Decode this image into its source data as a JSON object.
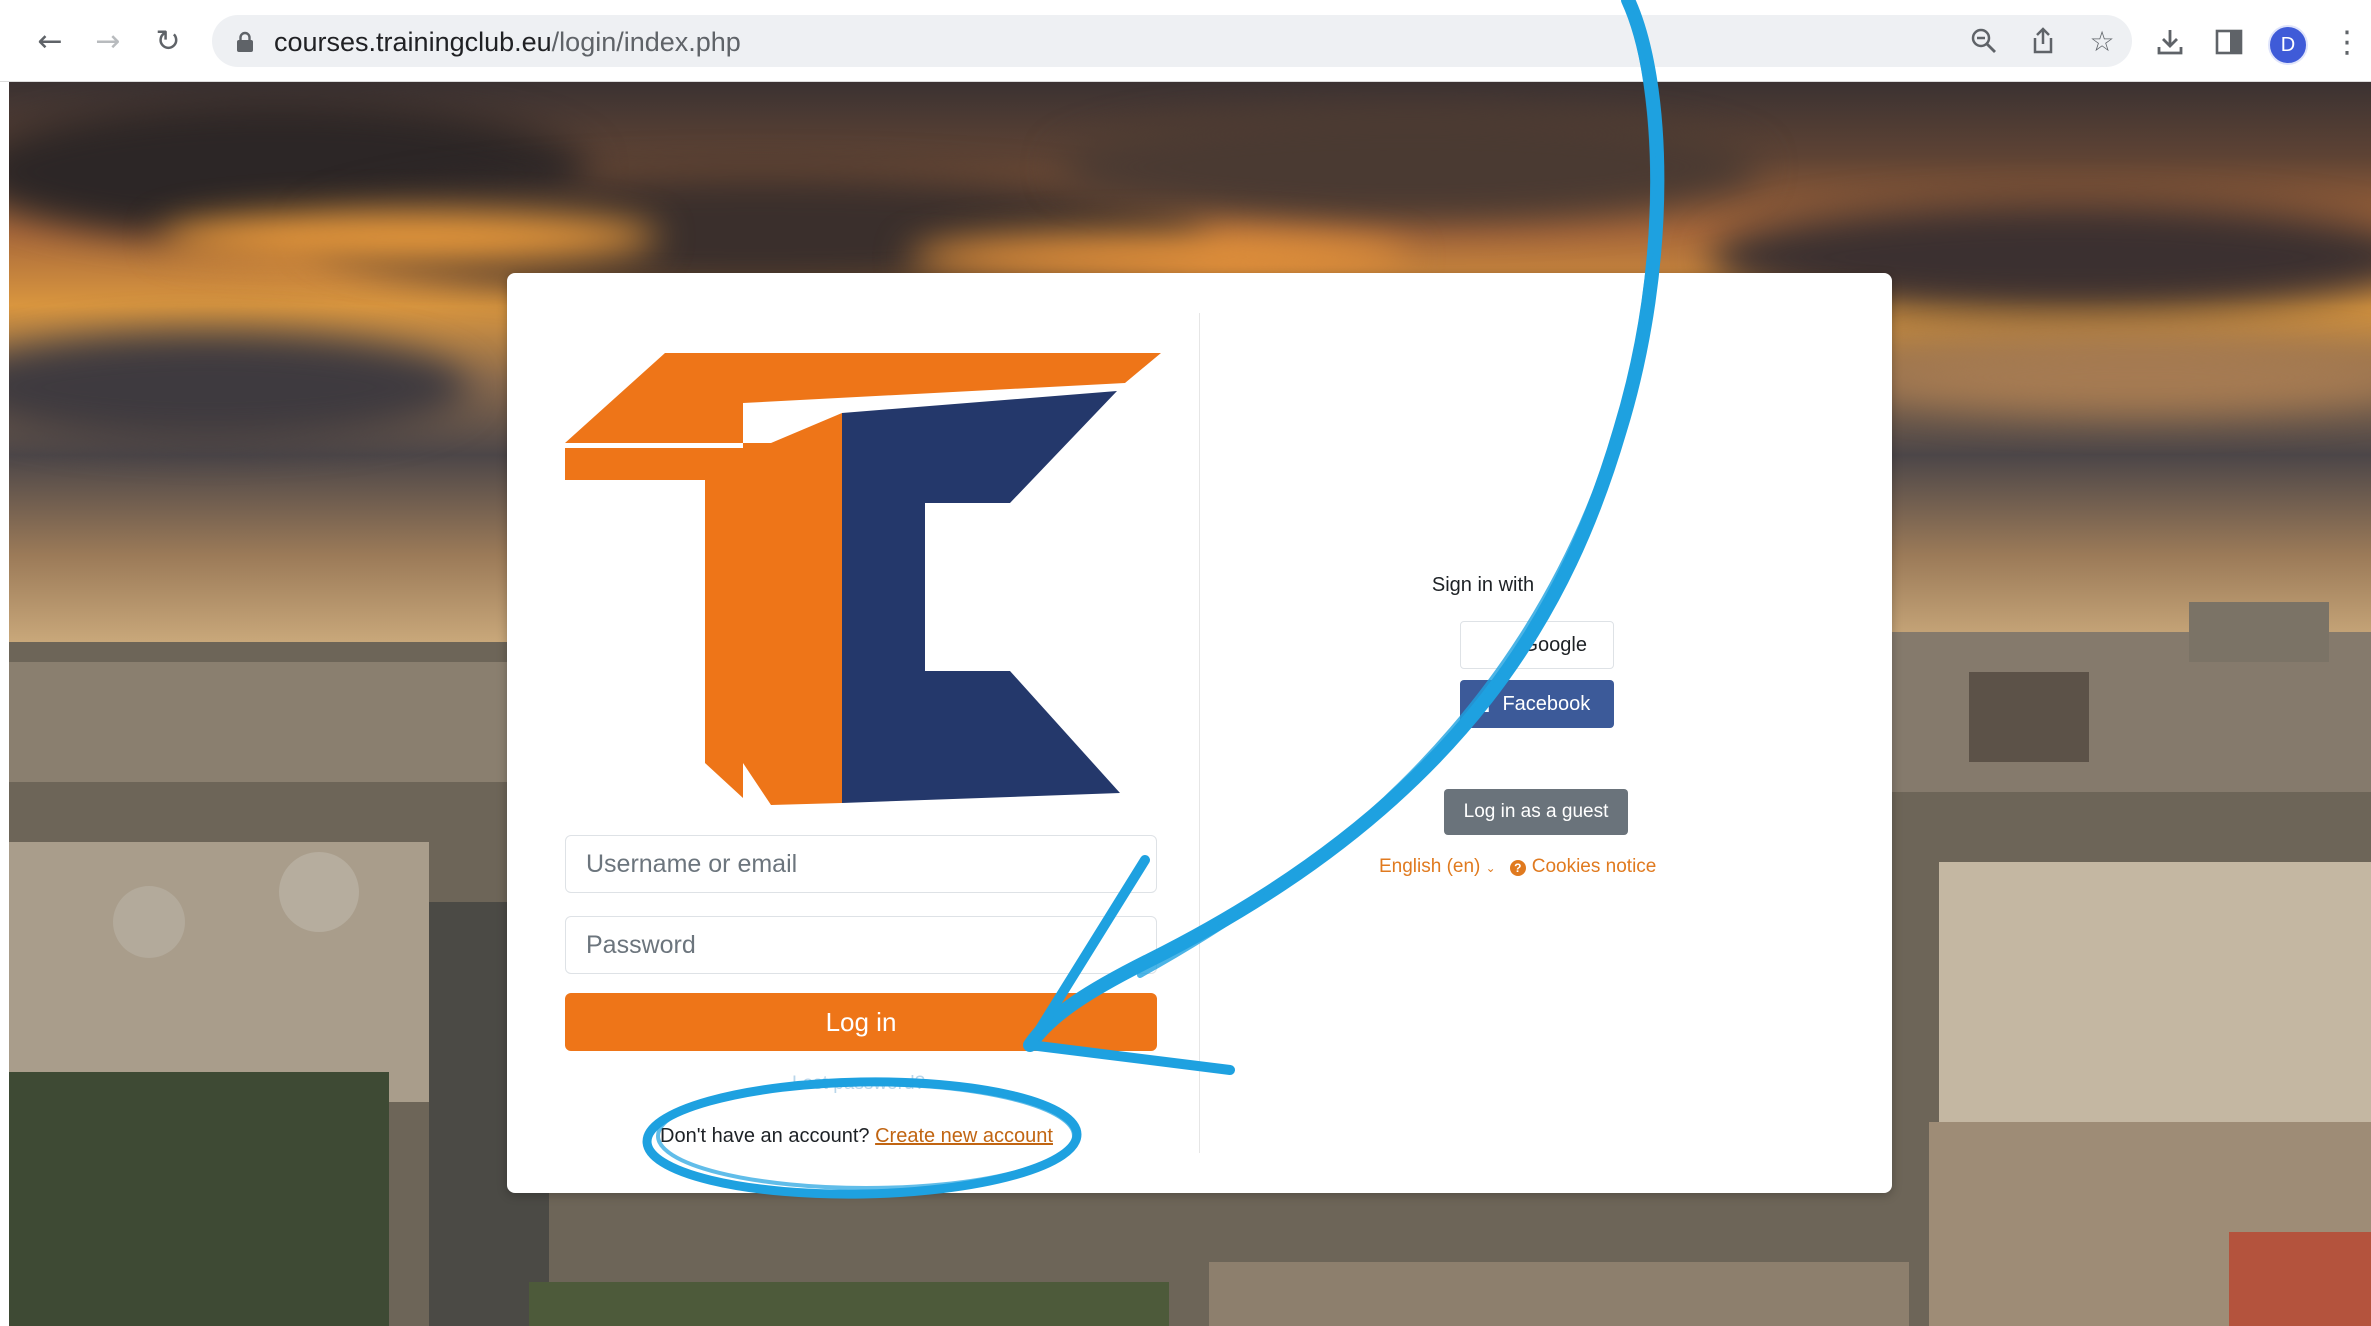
{
  "browser": {
    "url_domain": "courses.trainingclub.eu",
    "url_path": "/login/index.php",
    "profile_initial": "D",
    "icons": {
      "back": "arrow-left-icon",
      "forward": "arrow-right-icon",
      "reload": "reload-icon",
      "lock": "lock-icon",
      "zoom": "zoom-out-icon",
      "share": "share-icon",
      "bookmark": "star-icon",
      "download": "download-icon",
      "side_panel": "side-panel-icon",
      "menu": "kebab-menu-icon"
    }
  },
  "login": {
    "username_placeholder": "Username or email",
    "password_placeholder": "Password",
    "login_button": "Log in",
    "lost_password": "Lost password?",
    "no_account_text": "Don't have an account?",
    "create_account_link": "Create new account"
  },
  "sso": {
    "heading": "Sign in with",
    "google_label": "Google",
    "facebook_label": "Facebook",
    "guest_button": "Log in as a guest",
    "language": "English (en)",
    "cookies": "Cookies notice"
  },
  "colors": {
    "brand_orange": "#ee7518",
    "brand_navy": "#24386b",
    "annotation_blue": "#1ea1e0",
    "facebook_blue": "#3c5a99",
    "guest_gray": "#6a737b"
  }
}
